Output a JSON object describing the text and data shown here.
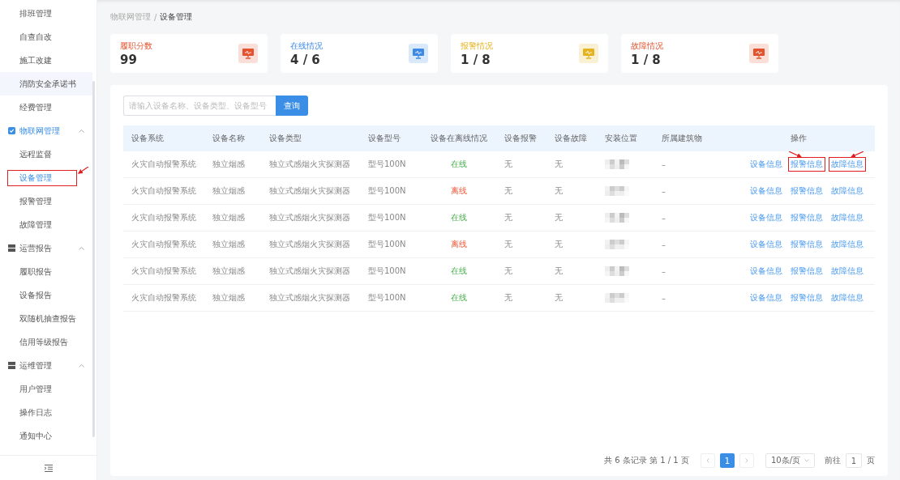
{
  "sidebar": {
    "items": [
      {
        "label": "排班管理",
        "kind": "item",
        "selected": false,
        "hovered": false
      },
      {
        "label": "自查自改",
        "kind": "item",
        "selected": false,
        "hovered": false
      },
      {
        "label": "施工改建",
        "kind": "item",
        "selected": false,
        "hovered": false
      },
      {
        "label": "消防安全承诺书",
        "kind": "item",
        "selected": false,
        "hovered": true
      },
      {
        "label": "经费管理",
        "kind": "item",
        "selected": false,
        "hovered": false
      },
      {
        "label": "物联网管理",
        "kind": "group",
        "expanded": true,
        "active": true,
        "children": [
          {
            "label": "远程监督",
            "selected": false,
            "highlighted": false
          },
          {
            "label": "设备管理",
            "selected": true,
            "highlighted": true
          },
          {
            "label": "报警管理",
            "selected": false,
            "highlighted": false
          },
          {
            "label": "故障管理",
            "selected": false,
            "highlighted": false
          }
        ]
      },
      {
        "label": "运营报告",
        "kind": "group",
        "expanded": true,
        "active": false,
        "children": [
          {
            "label": "履职报告",
            "selected": false,
            "highlighted": false
          },
          {
            "label": "设备报告",
            "selected": false,
            "highlighted": false
          },
          {
            "label": "双随机抽查报告",
            "selected": false,
            "highlighted": false
          },
          {
            "label": "信用等级报告",
            "selected": false,
            "highlighted": false
          }
        ]
      },
      {
        "label": "运维管理",
        "kind": "group",
        "expanded": true,
        "active": false,
        "children": [
          {
            "label": "用户管理",
            "selected": false,
            "highlighted": false
          },
          {
            "label": "操作日志",
            "selected": false,
            "highlighted": false
          },
          {
            "label": "通知中心",
            "selected": false,
            "highlighted": false
          }
        ]
      }
    ]
  },
  "breadcrumb": [
    "物联网管理",
    "/",
    "设备管理"
  ],
  "stats": [
    {
      "label": "履职分数",
      "value": "99",
      "color": "#e5532e"
    },
    {
      "label": "在线情况",
      "value": "4 / 6",
      "color": "#3d8ae6"
    },
    {
      "label": "报警情况",
      "value": "1 / 8",
      "color": "#e6b21f"
    },
    {
      "label": "故障情况",
      "value": "1 / 8",
      "color": "#e0532c"
    }
  ],
  "search": {
    "placeholder": "请输入设备名称、设备类型、设备型号",
    "button": "查询"
  },
  "table": {
    "columns": [
      "设备系统",
      "设备名称",
      "设备类型",
      "设备型号",
      "设备在离线情况",
      "设备报警",
      "设备故障",
      "安装位置",
      "所属建筑物",
      "操作"
    ],
    "rows": [
      {
        "system": "火灾自动报警系统",
        "name": "独立烟感",
        "type": "独立式感烟火灾探测器",
        "model": "型号100N",
        "status": "在线",
        "online": true,
        "alarm": "无",
        "fault": "无",
        "building": "–",
        "actions": [
          {
            "label": "设备信息",
            "highlighted": false
          },
          {
            "label": "报警信息",
            "highlighted": true
          },
          {
            "label": "故障信息",
            "highlighted": true
          }
        ]
      },
      {
        "system": "火灾自动报警系统",
        "name": "独立烟感",
        "type": "独立式感烟火灾探测器",
        "model": "型号100N",
        "status": "离线",
        "online": false,
        "alarm": "无",
        "fault": "无",
        "building": "–",
        "actions": [
          {
            "label": "设备信息",
            "highlighted": false
          },
          {
            "label": "报警信息",
            "highlighted": false
          },
          {
            "label": "故障信息",
            "highlighted": false
          }
        ]
      },
      {
        "system": "火灾自动报警系统",
        "name": "独立烟感",
        "type": "独立式感烟火灾探测器",
        "model": "型号100N",
        "status": "在线",
        "online": true,
        "alarm": "无",
        "fault": "无",
        "building": "–",
        "actions": [
          {
            "label": "设备信息",
            "highlighted": false
          },
          {
            "label": "报警信息",
            "highlighted": false
          },
          {
            "label": "故障信息",
            "highlighted": false
          }
        ]
      },
      {
        "system": "火灾自动报警系统",
        "name": "独立烟感",
        "type": "独立式感烟火灾探测器",
        "model": "型号100N",
        "status": "离线",
        "online": false,
        "alarm": "无",
        "fault": "无",
        "building": "–",
        "actions": [
          {
            "label": "设备信息",
            "highlighted": false
          },
          {
            "label": "报警信息",
            "highlighted": false
          },
          {
            "label": "故障信息",
            "highlighted": false
          }
        ]
      },
      {
        "system": "火灾自动报警系统",
        "name": "独立烟感",
        "type": "独立式感烟火灾探测器",
        "model": "型号100N",
        "status": "在线",
        "online": true,
        "alarm": "无",
        "fault": "无",
        "building": "–",
        "actions": [
          {
            "label": "设备信息",
            "highlighted": false
          },
          {
            "label": "报警信息",
            "highlighted": false
          },
          {
            "label": "故障信息",
            "highlighted": false
          }
        ]
      },
      {
        "system": "火灾自动报警系统",
        "name": "独立烟感",
        "type": "独立式感烟火灾探测器",
        "model": "型号100N",
        "status": "在线",
        "online": true,
        "alarm": "无",
        "fault": "无",
        "building": "–",
        "actions": [
          {
            "label": "设备信息",
            "highlighted": false
          },
          {
            "label": "报警信息",
            "highlighted": false
          },
          {
            "label": "故障信息",
            "highlighted": false
          }
        ]
      }
    ]
  },
  "pagination": {
    "summary": "共 6 条记录 第 1 / 1 页",
    "pages": [
      {
        "label": "1",
        "selected": true
      }
    ],
    "page_size": "10条/页",
    "goto_label": "前往",
    "goto_value": "1",
    "goto_unit": "页"
  }
}
